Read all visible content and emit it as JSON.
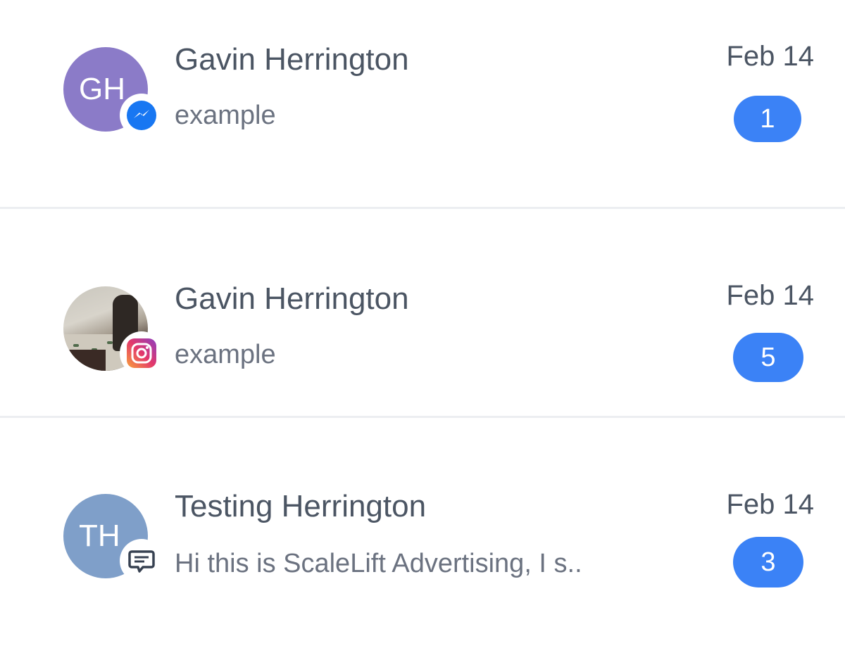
{
  "conversations": [
    {
      "name": "Gavin Herrington",
      "initials": "GH",
      "avatar_color": "#8b7bc8",
      "channel": "messenger-icon",
      "preview": "example",
      "date": "Feb 14",
      "unread": "1"
    },
    {
      "name": "Gavin Herrington",
      "initials": "",
      "avatar_color": "",
      "channel": "instagram-icon",
      "preview": "example",
      "date": "Feb 14",
      "unread": "5"
    },
    {
      "name": "Testing Herrington",
      "initials": "TH",
      "avatar_color": "#7f9fc9",
      "channel": "sms-chat-icon",
      "preview": "Hi this is ScaleLift Advertising, I s..",
      "date": "Feb 14",
      "unread": "3"
    }
  ],
  "colors": {
    "accent": "#3b82f6",
    "divider": "#eceef1",
    "name_text": "#4b5563",
    "preview_text": "#6b7280"
  }
}
